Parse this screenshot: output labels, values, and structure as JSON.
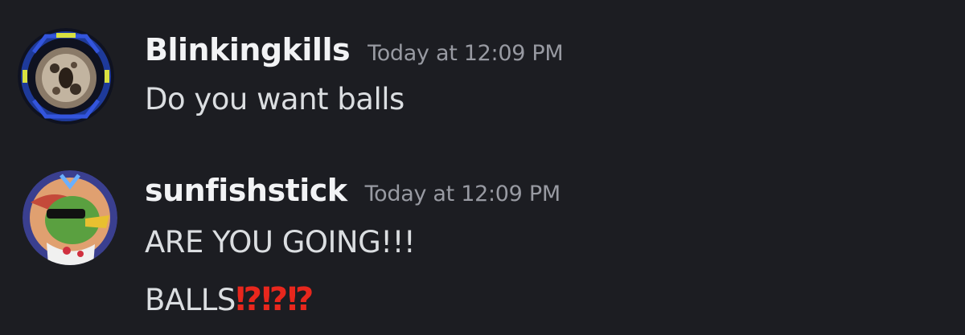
{
  "messages": [
    {
      "author": "Blinkingkills",
      "timestamp": "Today at 12:09 PM",
      "avatar_icon": "user-avatar-circuit-ring",
      "lines": [
        "Do you want balls"
      ]
    },
    {
      "author": "sunfishstick",
      "timestamp": "Today at 12:09 PM",
      "avatar_icon": "user-avatar-green-bird",
      "lines": [
        "ARE YOU GOING!!!",
        "BALLS"
      ],
      "trailing_emoji": "⁉⁉⁉"
    }
  ],
  "colors": {
    "background": "#1c1d22",
    "username": "#f2f3f5",
    "timestamp": "#989aa2",
    "message_text": "#dbdee1",
    "emoji": "#e8271d"
  }
}
